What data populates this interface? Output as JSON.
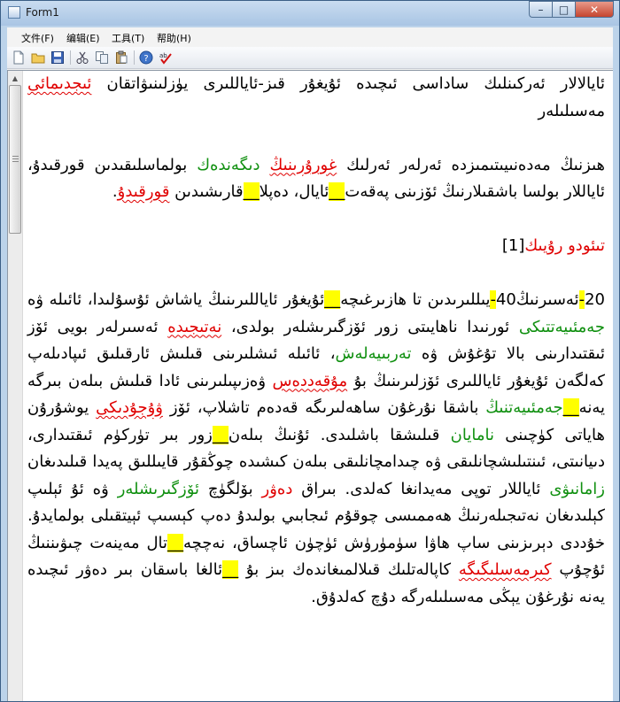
{
  "window": {
    "title": "Form1",
    "minimize": "–",
    "maximize": "□",
    "close": "✕"
  },
  "menu": {
    "file": "文件(F)",
    "edit": "编辑(E)",
    "tools": "工具(T)",
    "help": "帮助(H)"
  },
  "toolbar_icons": [
    "new-file-icon",
    "open-folder-icon",
    "save-icon",
    "cut-icon",
    "copy-icon",
    "paste-icon",
    "help-icon",
    "spell-check-icon"
  ],
  "colors": {
    "highlight": "#ffff00",
    "error": "#e00000",
    "suggestion": "#109010"
  },
  "content": {
    "p1": {
      "a": "ئايالالار ئەركىنلىك ساداسى ئىچىدە ئۇيغۇر قىز-ئاياللىرى يۈزلىنىۋاتقان ",
      "b": "ئىجدىمائى",
      "c": " مەسىلىلەر"
    },
    "p2": {
      "a": "ھىزنىڭ مەدەنىيىتىمىزدە ئەرلەر ئەرلىك ",
      "b": "غورۇرىنىڭ",
      "c": " ",
      "d": "دىگەندەك",
      "e": " بولماسلىقىدىن قورقىدۇ، ئاياللار بولسا باشقىلارنىڭ ئۆزىنى پەقەت",
      "f": "__",
      "g": "ئايال، دەپلا",
      "h": "__",
      "i": "قارىشىدىن ",
      "j": "قورقىدۇ",
      "k": "."
    },
    "p3": {
      "a": "تىئودو رۇيىك",
      "b": "[1]"
    },
    "p4": {
      "a": "20",
      "b": "-",
      "c": "ئەسىرنىڭ",
      "d": "40",
      "e": "-",
      "f": "يىللىرىدىن تا ھازىرغىچە",
      "g": "__",
      "h": "ئۇيغۇر ئاياللىرىنىڭ ياشاش ئۇسۇلىدا، ئائىلە ۋە ",
      "i": "جەمئىيەتتىكى",
      "j": " ئورنىدا ناھايىتى زور ئۆزگىرىشلەر بولدى، ",
      "k": "نەتىجىدە",
      "l": " ئەسىرلەر بويى ئۆز ئىقتىدارىنى بالا تۇغۇش ۋە ",
      "m": "تەربىيەلەش",
      "n": "، ئائىلە ئىشلىرىنى قىلىش ئارقىلىق ئىپادىلەپ كەلگەن ئۇيغۇر ئاياللىرى ئۆزلىرىنىڭ بۇ ",
      "o": "مۇقەددەس",
      "p": " ۋەزىپىلىرىنى ئادا قىلىش بىلەن بىرگە يەنە",
      "q": "__",
      "r": "جەمئىيەتنىڭ",
      "s": " باشقا نۇرغۇن ساھەلىرىگە قەدەم تاشلاپ، ئۆز ",
      "t": "ۋۇجۇدىكى",
      "u": " يوشۇرۇن ھاياتى كۈچىنى ",
      "v": "نامايان",
      "w": " قىلىشقا باشلىدى. ئۇنىڭ بىلەن",
      "x": "__",
      "y": "زور بىر تۈركۈم ئىقتىدارى، دىيانىتى، ئىنتىلىشچانلىقى ۋە چىدامچانلىقى بىلەن كىشىدە چوڭقۇر قايىللىق پەيدا قىلىدىغان ",
      "z": "زامانىۋى",
      "aa": " ئاياللار توپى مەيدانغا كەلدى. بىراق ",
      "ab": "دەۋر",
      "ac": " بۆلگۈچ ",
      "ad": "ئۆزگىرىشلەر",
      "ae": " ۋە ئۇ ئېلىپ كېلىدىغان نەتىجىلەرنىڭ ھەممىسى چوقۇم ئىجابىي بولىدۇ دەپ كېسىپ ئېيتقىلى بولمايدۇ. خۇددى دېرىزىنى ساپ ھاۋا سۈمۈرۈش ئۈچۈن ئاچساق، نەچچە",
      "af": "__",
      "ag": "تال مەينەت چىۋىننىڭ ئۇچۇپ ",
      "ah": "كىرمەسلىگىگە",
      "ai": " كاپالەتلىك قىلالمىغاندەك بىز بۇ ",
      "aj": "__",
      "ak": "ئالغا باسقان بىر دەۋر ئىچىدە يەنە نۇرغۇن يېڭى مەسىلىلەرگە دۇچ كەلدۇق."
    }
  }
}
